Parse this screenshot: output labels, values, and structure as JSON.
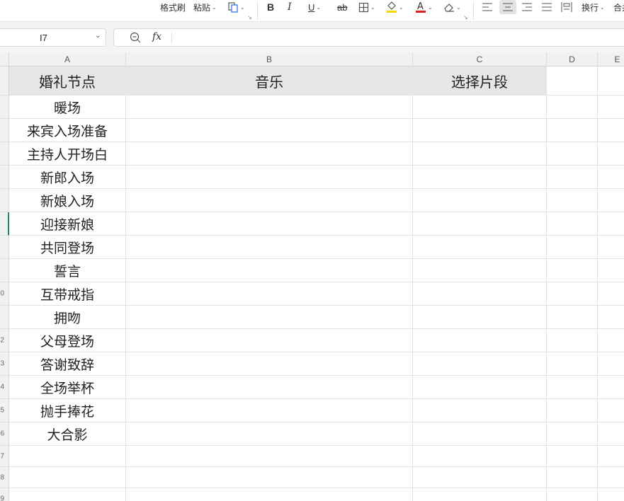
{
  "ribbon": {
    "format_painter": "格式刷",
    "paste": "粘贴",
    "wrap_text": "换行",
    "merge_partial": "合并"
  },
  "formula_bar": {
    "cell_ref": "I7",
    "fx_label": "fx",
    "formula_value": ""
  },
  "sheet": {
    "column_headers": [
      "A",
      "B",
      "C",
      "D",
      "E"
    ],
    "header_row": {
      "a": "婚礼节点",
      "b": "音乐",
      "c": "选择片段"
    },
    "row_number_fragments": [
      "",
      "",
      "",
      "",
      "",
      "",
      "",
      "",
      "",
      "0",
      "",
      "2",
      "3",
      "4",
      "5",
      "6",
      "7",
      "8",
      "9"
    ],
    "wedding_steps": [
      "暖场",
      "来宾入场准备",
      "主持人开场白",
      "新郎入场",
      "新娘入场",
      "迎接新娘",
      "共同登场",
      "誓言",
      "互带戒指",
      "拥吻",
      "父母登场",
      "答谢致辞",
      "全场举杯",
      "抛手捧花",
      "大合影"
    ],
    "active_row_index": 6
  },
  "colors": {
    "header_fill": "#e6e6e6",
    "accent_green": "#1e8a5a",
    "font_color_underline": "#e02020",
    "highlight_underline": "#f5d800"
  }
}
